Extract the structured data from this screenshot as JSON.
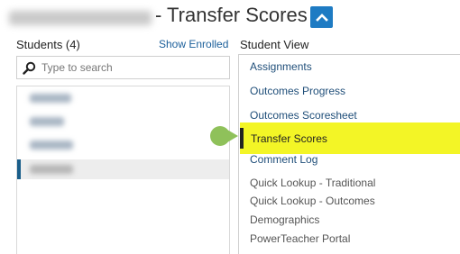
{
  "header": {
    "title": "- Transfer Scores",
    "toggle_icon": "chevron-up-icon",
    "accent_color": "#1e7bc3"
  },
  "students": {
    "header": "Students (4)",
    "show_enrolled_label": "Show Enrolled",
    "search_placeholder": "Type to search",
    "search_icon": "search-icon",
    "selected_index": 3
  },
  "student_view": {
    "header": "Student View",
    "items": [
      {
        "label": "Assignments"
      },
      {
        "label": "Outcomes Progress"
      },
      {
        "label": "Outcomes Scoresheet"
      },
      {
        "label": "Transfer Scores"
      },
      {
        "label": "Comment Log"
      },
      {
        "label": "Quick Lookup - Traditional"
      },
      {
        "label": "Quick Lookup - Outcomes"
      },
      {
        "label": "Demographics"
      },
      {
        "label": "PowerTeacher Portal"
      }
    ],
    "active_item": "Transfer Scores",
    "highlight_color": "#f3f526",
    "pointer_color": "#8fc15a"
  }
}
